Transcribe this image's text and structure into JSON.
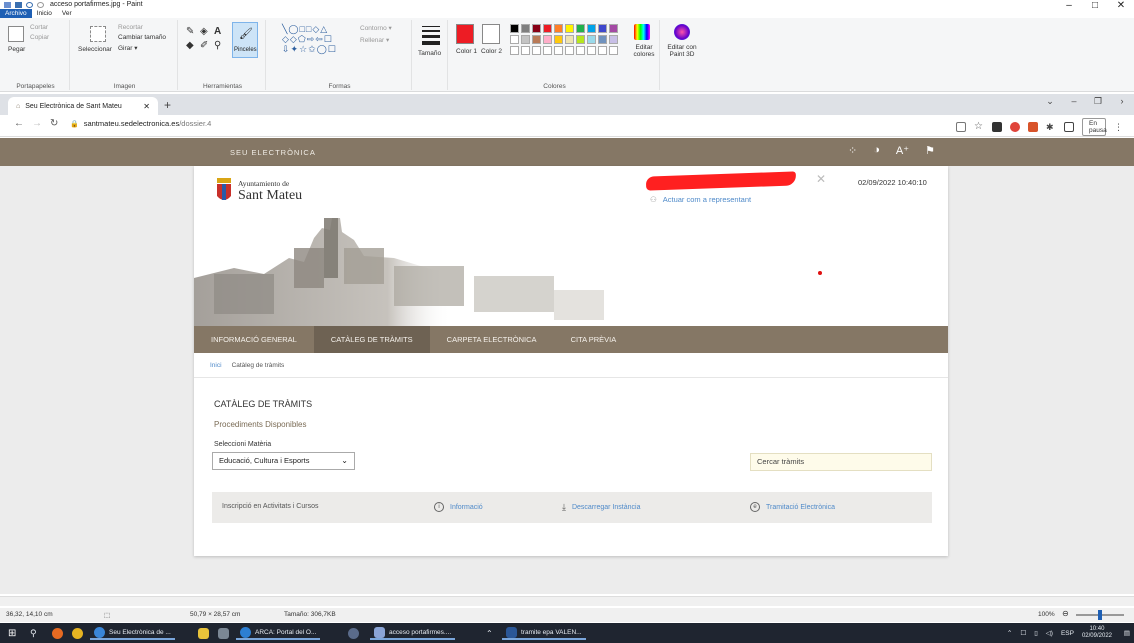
{
  "paint": {
    "title": "acceso portafirmes.jpg - Paint",
    "tabs": [
      "Archivo",
      "Inicio",
      "Ver"
    ],
    "window_controls": [
      "–",
      "□",
      "✕"
    ],
    "ribbon": {
      "clipboard": {
        "paste": "Pegar",
        "cut": "Cortar",
        "copy": "Copiar",
        "group": "Portapapeles"
      },
      "image": {
        "select": "Seleccionar",
        "crop": "Recortar",
        "resize": "Cambiar tamaño",
        "rotate": "Girar ▾",
        "group": "Imagen"
      },
      "tools": {
        "brushes": "Pinceles",
        "group": "Herramientas"
      },
      "shapes": {
        "outline": "Contorno ▾",
        "fill": "Rellenar ▾",
        "group": "Formas"
      },
      "size": {
        "label": "Tamaño"
      },
      "colors": {
        "color1": "Color 1",
        "color2": "Color 2",
        "edit": "Editar colores",
        "group": "Colores",
        "edit3d": "Editar con Paint 3D"
      }
    },
    "status": {
      "cursor": "36,32, 14,10 cm",
      "selection": "50,79 × 28,57 cm",
      "size": "Tamaño: 306,7KB",
      "zoom": "100%"
    },
    "colors": {
      "row1": [
        "#000000",
        "#7f7f7f",
        "#880015",
        "#ed1c24",
        "#ff7f27",
        "#fff200",
        "#22b14c",
        "#00a2e8",
        "#3f48cc",
        "#a349a4"
      ],
      "row2": [
        "#ffffff",
        "#c3c3c3",
        "#b97a57",
        "#ffaec9",
        "#ffc90e",
        "#efe4b0",
        "#b5e61d",
        "#99d9ea",
        "#7092be",
        "#c8bfe7"
      ],
      "active": "#ed1c24"
    }
  },
  "browser": {
    "tab_title": "Seu Electrònica de Sant Mateu",
    "url_domain": "santmateu.sedelectronica.es",
    "url_path": "/dossier.4",
    "profile_status": "En pausa"
  },
  "site": {
    "top_label": "SEU ELECTRÒNICA",
    "logo_sub": "Ayuntamiento de",
    "logo_name": "Sant Mateu",
    "datetime": "02/09/2022 10:40:10",
    "represent": "Actuar com a representant",
    "nav": [
      "INFORMACIÓ GENERAL",
      "CATÀLEG DE TRÀMITS",
      "CARPETA ELECTRÒNICA",
      "CITA PRÈVIA"
    ],
    "breadcrumb_home": "Inici",
    "breadcrumb_current": "Catàleg de tràmits",
    "catalog_title": "CATÀLEG DE TRÀMITS",
    "procedures": "Procediments Disponibles",
    "select_label": "Seleccioni Matèria",
    "select_value": "Educació, Cultura i Esports",
    "search_placeholder": "Cercar tràmits",
    "row": {
      "name": "Inscripció en Activitats i Cursos",
      "info": "Informació",
      "download": "Descarregar Instància",
      "electronic": "Tramitació Electrònica"
    },
    "brand_color": "#857765"
  },
  "taskbar": {
    "apps": [
      "Seu Electrònica de ...",
      "ARCA: Portal del O...",
      "acceso portafirmes....",
      "tramite epa VALEN..."
    ],
    "lang": "ESP",
    "time": "10:40",
    "date": "02/09/2022"
  }
}
